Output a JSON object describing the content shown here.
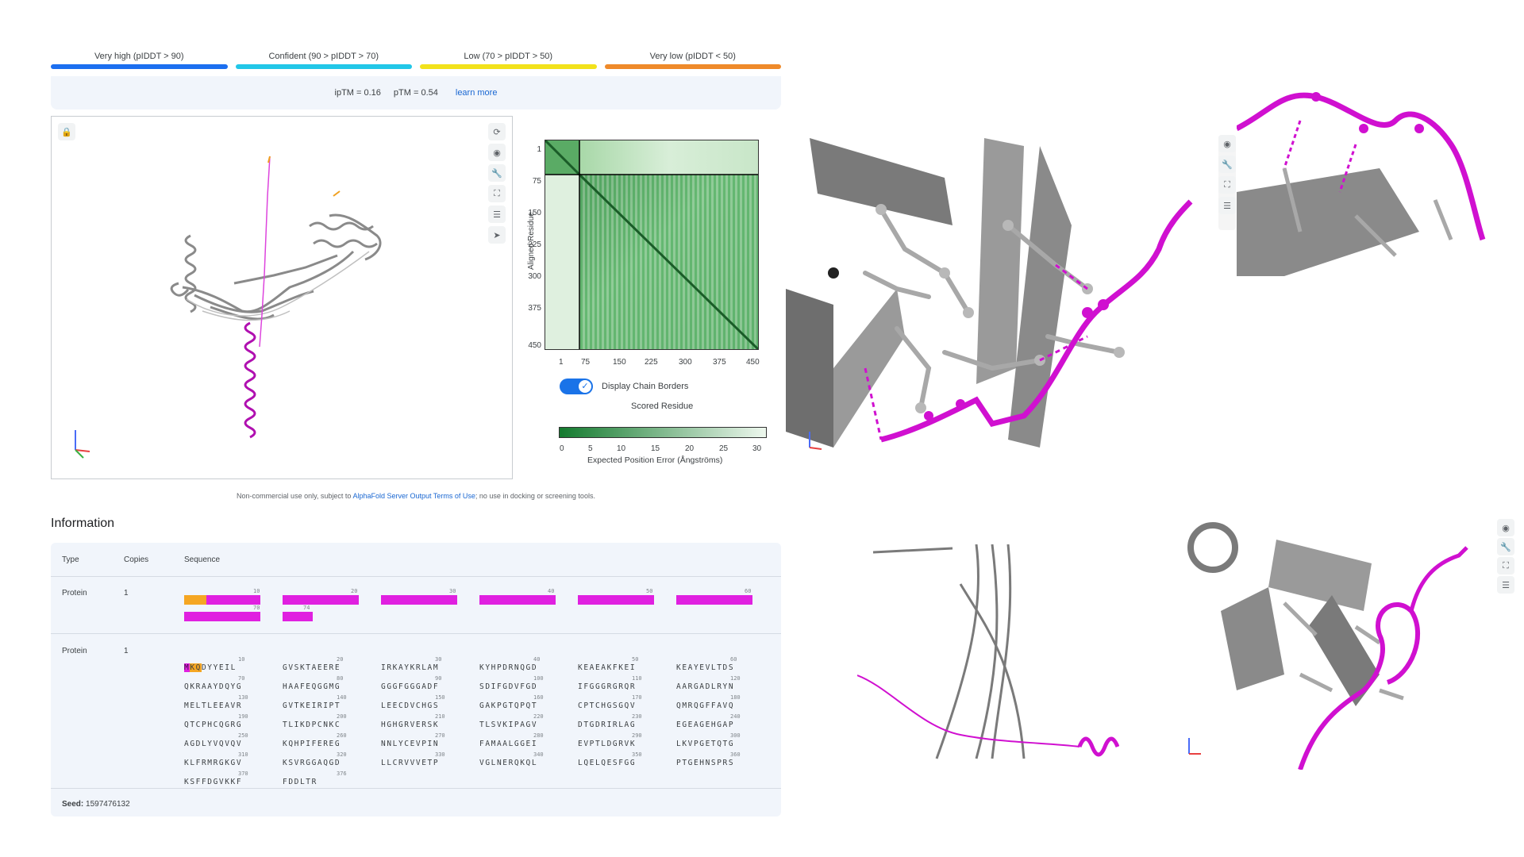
{
  "legend": [
    {
      "label": "Very high (pIDDT > 90)",
      "color": "#1c6ff0"
    },
    {
      "label": "Confident (90 > pIDDT > 70)",
      "color": "#22c7e8"
    },
    {
      "label": "Low (70 > pIDDT > 50)",
      "color": "#f2e21b"
    },
    {
      "label": "Very low (pIDDT < 50)",
      "color": "#ef8a2a"
    }
  ],
  "metrics": {
    "iptm": "ipTM = 0.16",
    "ptm": "pTM = 0.54",
    "learn_more": "learn more"
  },
  "pae": {
    "y_label": "Aligned Residue",
    "x_label": "Scored Residue",
    "ticks": [
      "1",
      "75",
      "150",
      "225",
      "300",
      "375",
      "450"
    ],
    "display_chain_borders": "Display Chain Borders",
    "colorbar_ticks": [
      "0",
      "5",
      "10",
      "15",
      "20",
      "25",
      "30"
    ],
    "colorbar_label": "Expected Position Error (Ångströms)"
  },
  "footnote": {
    "pre": "Non-commercial use only, subject to ",
    "link": "AlphaFold Server Output Terms of Use",
    "post": "; no use in docking or screening tools."
  },
  "information": {
    "title": "Information",
    "headers": {
      "type": "Type",
      "copies": "Copies",
      "sequence": "Sequence"
    },
    "rows": [
      {
        "type": "Protein",
        "copies": "1"
      },
      {
        "type": "Protein",
        "copies": "1"
      }
    ],
    "seed_label": "Seed:",
    "seed_value": "1597476132"
  },
  "seq2": {
    "nums": [
      [
        "10",
        "20",
        "30",
        "40",
        "50",
        "60"
      ],
      [
        "70",
        "80",
        "90",
        "100",
        "110",
        "120"
      ],
      [
        "130",
        "140",
        "150",
        "160",
        "170",
        "180"
      ],
      [
        "190",
        "200",
        "210",
        "220",
        "230",
        "240"
      ],
      [
        "250",
        "260",
        "270",
        "280",
        "290",
        "300"
      ],
      [
        "310",
        "320",
        "330",
        "340",
        "350",
        "360"
      ],
      [
        "370",
        "376"
      ]
    ],
    "lines": [
      [
        "DYYEIL",
        "GVSKTAEERE",
        "IRKAYKRLAM",
        "KYHPDRNQGD",
        "KEAEAKFKEI",
        "KEAYEVLTDS"
      ],
      [
        "QKRAAYDQYG",
        "HAAFEQGGMG",
        "GGGFGGGADF",
        "SDIFGDVFGD",
        "IFGGGRGRQR",
        "AARGADLRYN"
      ],
      [
        "MELTLEEAVR",
        "GVTKEIRIPT",
        "LEECDVCHGS",
        "GAKPGTQPQT",
        "CPTCHGSGQV",
        "QMRQGFFAVQ"
      ],
      [
        "QTCPHCQGRG",
        "TLIKDPCNKC",
        "HGHGRVERSK",
        "TLSVKIPAGV",
        "DTGDRIRLAG",
        "EGEAGEHGAP"
      ],
      [
        "AGDLYVQVQV",
        "KQHPIFEREG",
        "NNLYCEVPIN",
        "FAMAALGGEI",
        "EVPTLDGRVK",
        "LKVPGETQTG"
      ],
      [
        "KLFRMRGKGV",
        "KSVRGGAQGD",
        "LLCRVVVETP",
        "VGLNERQKQL",
        "LQELQESFGG",
        "PTGEHNSPRS"
      ],
      [
        "KSFFDGVKKF",
        "FDDLTR"
      ]
    ],
    "first_prefix_magenta": "M",
    "first_prefix_orange": "KQ"
  },
  "seq1": {
    "nums": [
      [
        "10",
        "20",
        "30",
        "40",
        "50",
        "60"
      ],
      [
        "70",
        "74"
      ]
    ]
  }
}
